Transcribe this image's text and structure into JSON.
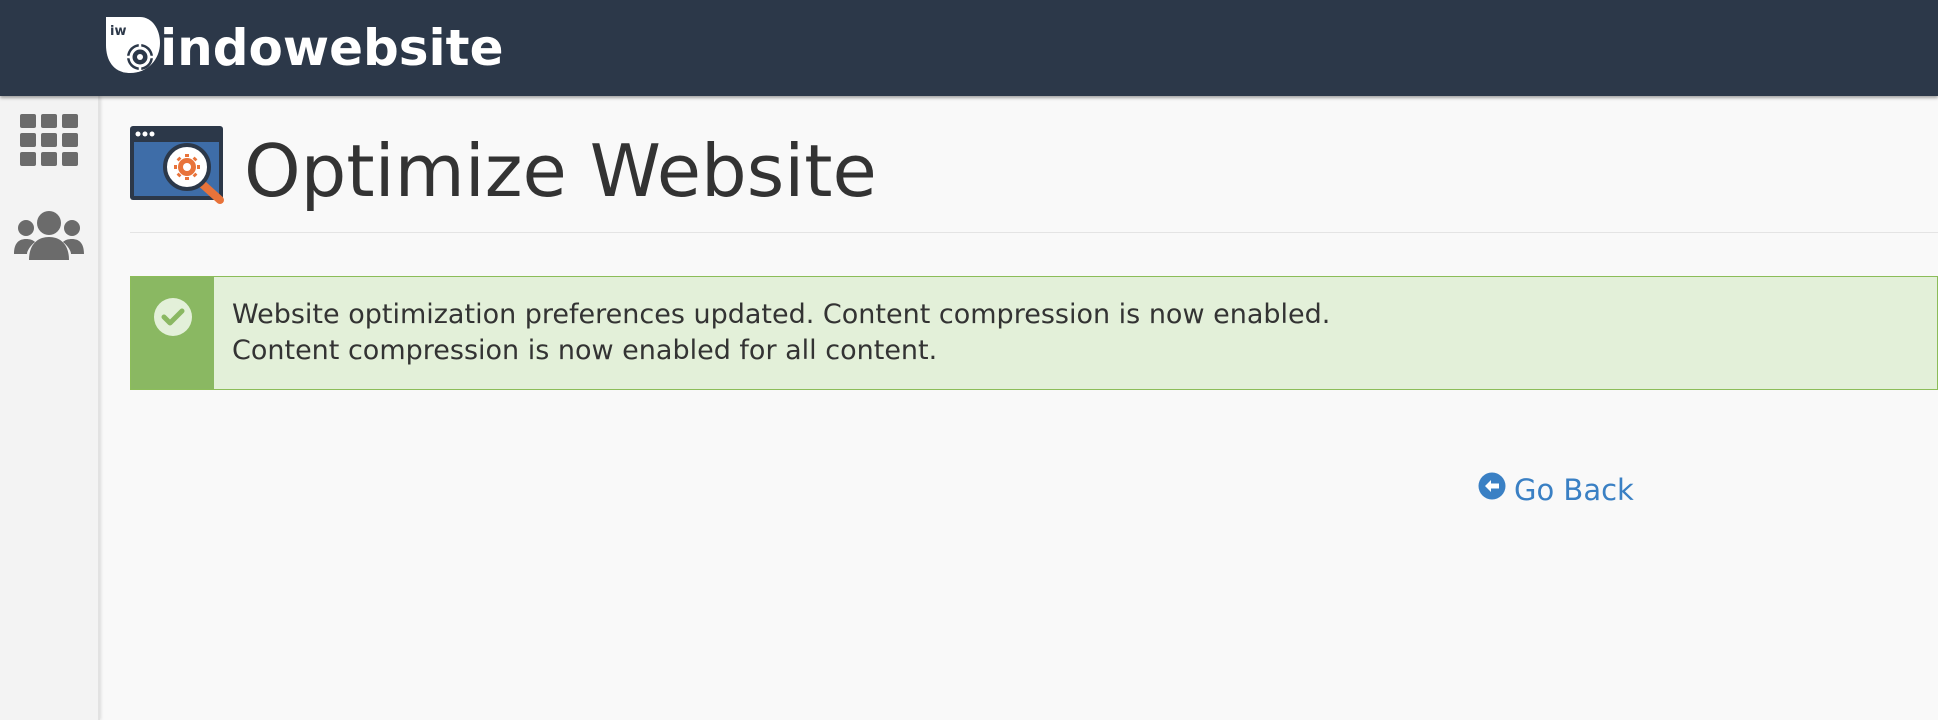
{
  "header": {
    "brand_name": "indowebsite",
    "logo_icon": "indowebsite-logo-icon",
    "logo_mark_text": "iw",
    "bg_color": "#2c3849"
  },
  "sidebar": {
    "items": [
      {
        "icon": "grid-apps-icon",
        "label": ""
      },
      {
        "icon": "users-icon",
        "label": ""
      }
    ]
  },
  "page": {
    "title": "Optimize Website",
    "icon": "optimize-website-icon"
  },
  "alert": {
    "type": "success",
    "icon": "check-circle-icon",
    "line1": "Website optimization preferences updated. Content compression is now enabled.",
    "line2": "Content compression is now enabled for all content.",
    "bg_color": "#e3f0d9",
    "accent_color": "#8ab862"
  },
  "actions": {
    "go_back_label": "Go Back",
    "go_back_icon": "arrow-circle-left-icon",
    "link_color": "#3a80c4"
  }
}
